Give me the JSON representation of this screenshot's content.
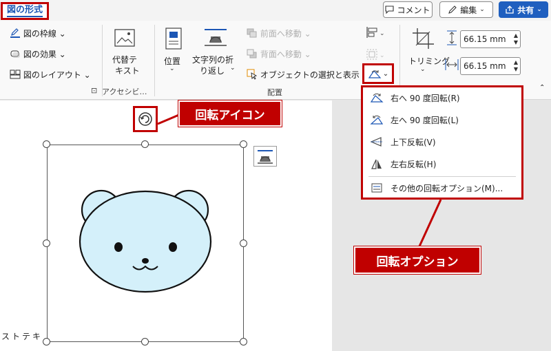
{
  "tabs": {
    "active": "図の形式"
  },
  "top_buttons": {
    "comment": "コメント",
    "edit": "編集",
    "share": "共有"
  },
  "ribbon": {
    "style": {
      "border": "図の枠線",
      "effects": "図の効果",
      "layout": "図のレイアウト"
    },
    "accessibility": {
      "alt_text_line1": "代替テ",
      "alt_text_line2": "キスト",
      "group_name": "アクセシビ…"
    },
    "arrange": {
      "position": "位置",
      "wrap_line1": "文字列の折",
      "wrap_line2": "り返し",
      "bring_forward": "前面へ移動",
      "send_backward": "背面へ移動",
      "selection_pane": "オブジェクトの選択と表示",
      "group_name": "配置"
    },
    "size": {
      "crop": "トリミング",
      "height": "66.15 mm",
      "width": "66.15 mm"
    }
  },
  "rotate_menu": {
    "items": [
      {
        "label": "右へ 90 度回転(R)",
        "icon": "rotate-right-icon"
      },
      {
        "label": "左へ 90 度回転(L)",
        "icon": "rotate-left-icon"
      },
      {
        "label": "上下反転(V)",
        "icon": "flip-vertical-icon"
      },
      {
        "label": "左右反転(H)",
        "icon": "flip-horizontal-icon"
      },
      {
        "label": "その他の回転オプション(M)...",
        "icon": "more-rotation-options-icon"
      }
    ]
  },
  "annotations": {
    "rotate_icon": "回転アイコン",
    "rotate_options": "回転オプション"
  },
  "document": {
    "side_text": "ストテキ"
  },
  "colors": {
    "accent_red": "#c00000",
    "brand_blue": "#1f5fbf",
    "bear_fill": "#d4f0fa"
  }
}
